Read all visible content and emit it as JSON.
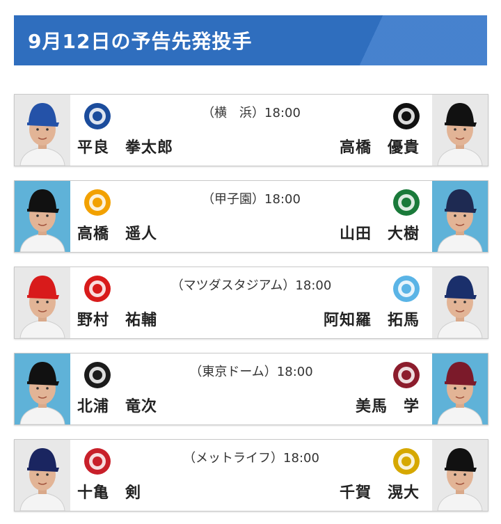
{
  "header": {
    "title": "9月12日の予告先発投手"
  },
  "games": [
    {
      "venue": "（横　浜）18:00",
      "left": {
        "pitcher": "平良　拳太郎",
        "team_logo": "baystars-logo",
        "logo_color": "#1b4c9c",
        "photo_bg": "#e8e8e8",
        "cap": "#2452a8"
      },
      "right": {
        "pitcher": "高橋　優貴",
        "team_logo": "giants-logo",
        "logo_color": "#111111",
        "photo_bg": "#e8e8e8",
        "cap": "#111111"
      }
    },
    {
      "venue": "（甲子園）18:00",
      "left": {
        "pitcher": "高橋　遥人",
        "team_logo": "tigers-logo",
        "logo_color": "#f2a100",
        "photo_bg": "#5fb2d8",
        "cap": "#111111"
      },
      "right": {
        "pitcher": "山田　大樹",
        "team_logo": "swallows-logo",
        "logo_color": "#1a7a3a",
        "photo_bg": "#5fb2d8",
        "cap": "#1e2a52"
      }
    },
    {
      "venue": "（マツダスタジアム）18:00",
      "left": {
        "pitcher": "野村　祐輔",
        "team_logo": "carp-logo",
        "logo_color": "#d81b1b",
        "photo_bg": "#e8e8e8",
        "cap": "#d81b1b"
      },
      "right": {
        "pitcher": "阿知羅　拓馬",
        "team_logo": "dragons-logo",
        "logo_color": "#5ab4e6",
        "photo_bg": "#e8e8e8",
        "cap": "#1a2f6b"
      }
    },
    {
      "venue": "（東京ドーム）18:00",
      "left": {
        "pitcher": "北浦　竜次",
        "team_logo": "fighters-logo",
        "logo_color": "#1b1b1b",
        "photo_bg": "#5fb2d8",
        "cap": "#111111"
      },
      "right": {
        "pitcher": "美馬　学",
        "team_logo": "eagles-logo",
        "logo_color": "#8c1c2c",
        "photo_bg": "#5fb2d8",
        "cap": "#7b1a2a"
      }
    },
    {
      "venue": "（メットライフ）18:00",
      "left": {
        "pitcher": "十亀　剣",
        "team_logo": "lions-logo",
        "logo_color": "#c8202a",
        "photo_bg": "#e8e8e8",
        "cap": "#1a2560"
      },
      "right": {
        "pitcher": "千賀　滉大",
        "team_logo": "hawks-logo",
        "logo_color": "#d6a800",
        "photo_bg": "#e8e8e8",
        "cap": "#111111"
      }
    }
  ]
}
